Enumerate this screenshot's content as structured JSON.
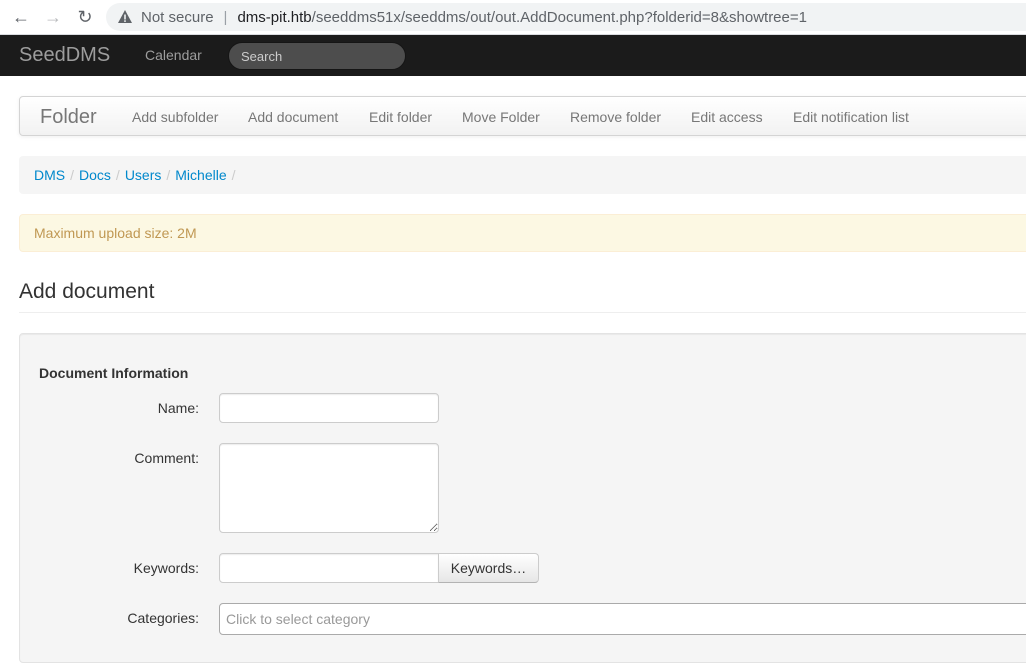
{
  "browser": {
    "security_label": "Not secure",
    "url_host": "dms-pit.htb",
    "url_rest": "/seeddms51x/seeddms/out/out.AddDocument.php?folderid=8&showtree=1",
    "back_icon": "←",
    "forward_icon": "→",
    "reload_icon": "↻"
  },
  "navbar": {
    "brand": "SeedDMS",
    "calendar": "Calendar",
    "search_placeholder": "Search"
  },
  "folder_menu": {
    "title": "Folder",
    "items": [
      "Add subfolder",
      "Add document",
      "Edit folder",
      "Move Folder",
      "Remove folder",
      "Edit access",
      "Edit notification list"
    ]
  },
  "breadcrumb": {
    "items": [
      "DMS",
      "Docs",
      "Users",
      "Michelle"
    ],
    "divider": "/"
  },
  "alert": {
    "text": "Maximum upload size: 2M"
  },
  "page": {
    "title": "Add document"
  },
  "form": {
    "legend": "Document Information",
    "name_label": "Name:",
    "name_value": "",
    "comment_label": "Comment:",
    "comment_value": "",
    "keywords_label": "Keywords:",
    "keywords_value": "",
    "keywords_button": "Keywords…",
    "categories_label": "Categories:",
    "categories_placeholder": "Click to select category"
  }
}
